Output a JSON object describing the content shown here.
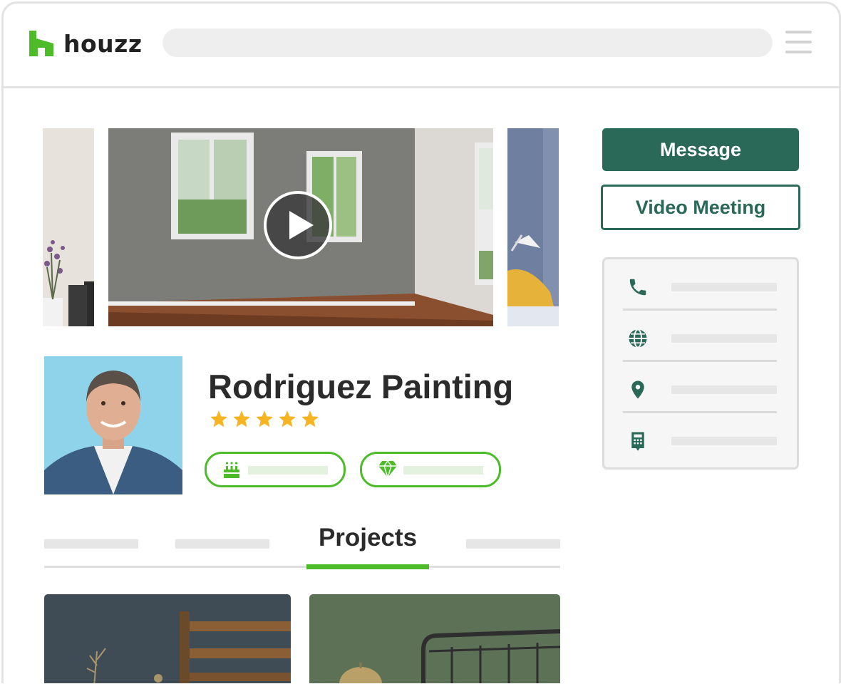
{
  "header": {
    "logo_text": "houzz",
    "brand_color": "#4dbb2a"
  },
  "hero": {
    "play_icon": "play-icon"
  },
  "actions": {
    "message_label": "Message",
    "video_meeting_label": "Video Meeting",
    "accent_color": "#2a6858"
  },
  "contact": {
    "icons": [
      "phone-icon",
      "globe-icon",
      "location-pin-icon",
      "calculator-icon"
    ]
  },
  "profile": {
    "name": "Rodriguez Painting",
    "rating_stars": 5,
    "badges": [
      "anniversary-cake-icon",
      "diamond-icon"
    ]
  },
  "tabs": {
    "active_label": "Projects"
  }
}
